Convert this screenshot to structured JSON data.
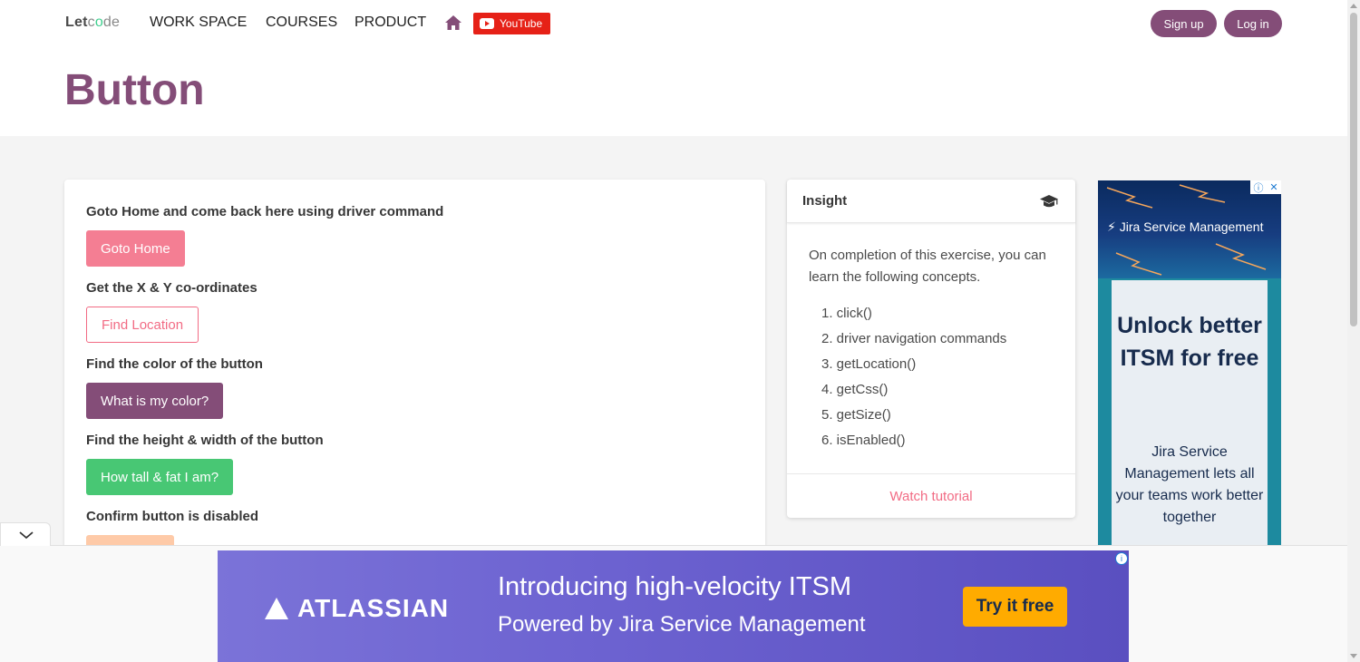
{
  "brand": {
    "part1": "Let",
    "part2": "c",
    "part3": "o",
    "part4": "de"
  },
  "nav": {
    "links": [
      "WORK SPACE",
      "COURSES",
      "PRODUCT"
    ],
    "youtube_label": "YouTube",
    "signup_label": "Sign up",
    "login_label": "Log in"
  },
  "page": {
    "title": "Button"
  },
  "exercises": [
    {
      "question": "Goto Home and come back here using driver command",
      "button": "Goto Home"
    },
    {
      "question": "Get the X & Y co-ordinates",
      "button": "Find Location"
    },
    {
      "question": "Find the color of the button",
      "button": "What is my color?"
    },
    {
      "question": "Find the height & width of the button",
      "button": "How tall & fat I am?"
    },
    {
      "question": "Confirm button is disabled",
      "button": ""
    }
  ],
  "insight": {
    "title": "Insight",
    "intro": "On completion of this exercise, you can learn the following concepts.",
    "concepts": [
      "1. click()",
      "2. driver navigation commands",
      "3. getLocation()",
      "4. getCss()",
      "5. getSize()",
      "6. isEnabled()"
    ],
    "footer": "Watch tutorial"
  },
  "side_ad": {
    "brand": "Jira Service Management",
    "headline": "Unlock better ITSM for free",
    "body": "Jira Service Management lets all your teams work better together"
  },
  "bottom_ad": {
    "logo": "ATLASSIAN",
    "line1": "Introducing high-velocity ITSM",
    "line2": "Powered by Jira Service Management",
    "cta": "Try it free"
  },
  "colors": {
    "primary": "#844d78",
    "pink": "#f47e93",
    "success": "#48c774",
    "warning_light": "#fecaa8",
    "youtube": "#e62117"
  }
}
